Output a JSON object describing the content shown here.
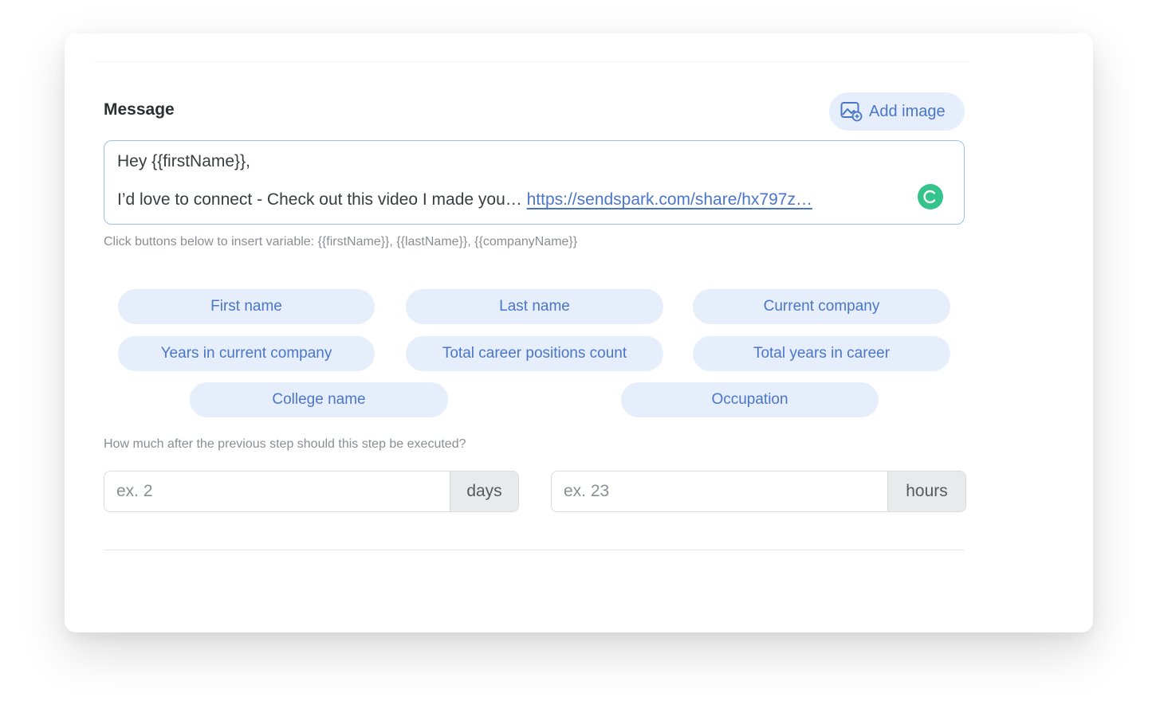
{
  "message": {
    "title": "Message",
    "add_image_label": "Add image",
    "line1": "Hey {{firstName}},",
    "line2_text": "I’d love to connect - Check out this video I made you…",
    "line2_link": "https://sendspark.com/share/hx797z…"
  },
  "variables": {
    "hint": "Click buttons below to insert variable: {{firstName}}, {{lastName}}, {{companyName}}",
    "buttons": [
      "First name",
      "Last name",
      "Current company",
      "Years in current company",
      "Total career positions count",
      "Total years in career",
      "College name",
      "Occupation"
    ]
  },
  "delay": {
    "hint": "How much after the previous step should this step be executed?",
    "days_placeholder": "ex. 2",
    "days_unit": "days",
    "hours_placeholder": "ex. 23",
    "hours_unit": "hours"
  },
  "colors": {
    "accent": "#4a76c9",
    "chip_bg": "#e6eefc",
    "grammar_green": "#34c48b"
  },
  "icons": {
    "add_image": "image-add-icon",
    "grammar": "grammar-check-icon"
  }
}
